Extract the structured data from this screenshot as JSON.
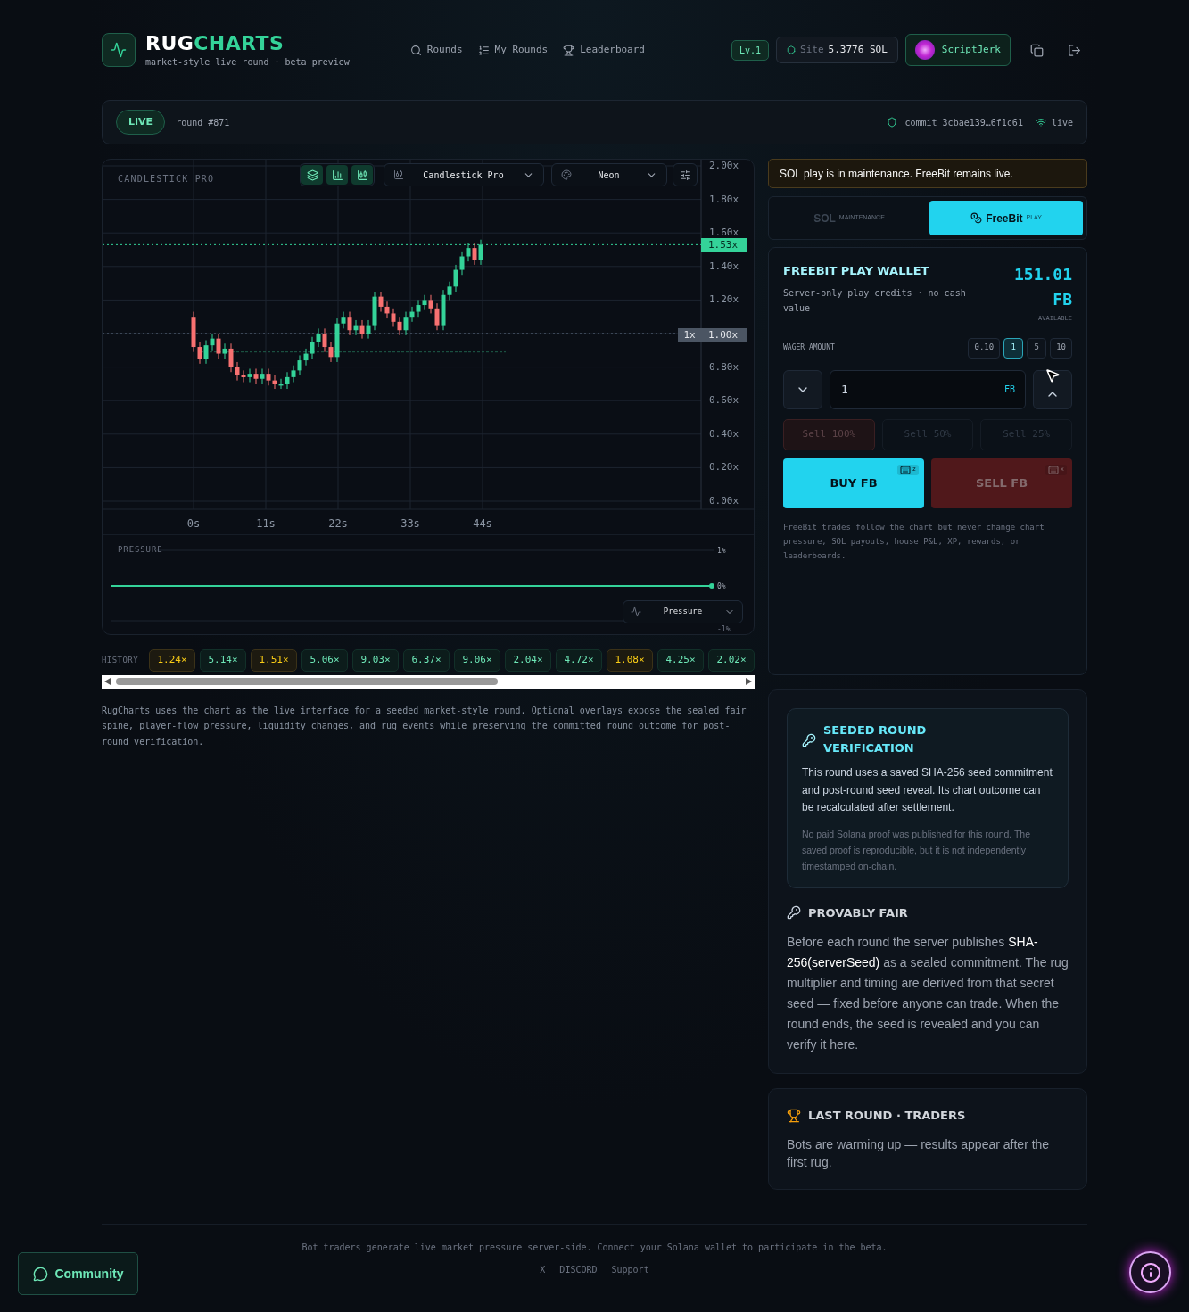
{
  "header": {
    "logo_part_1": "RUG",
    "logo_part_2": "CHARTS",
    "tagline": "market-style live round · beta preview",
    "nav": [
      {
        "label": "Rounds"
      },
      {
        "label": "My Rounds"
      },
      {
        "label": "Leaderboard"
      }
    ],
    "level": "Lv.1",
    "site_label": "Site",
    "site_value": "5.3776 SOL",
    "user": "ScriptJerk"
  },
  "round_bar": {
    "status": "LIVE",
    "round": "round #871",
    "commit": "commit 3cbae139…6f1c61",
    "connection": "live"
  },
  "chart": {
    "title": "CANDLESTICK PRO",
    "style_select": "Candlestick Pro",
    "theme_select": "Neon",
    "y_ticks": [
      "2.00x",
      "1.80x",
      "1.60x",
      "1.40x",
      "1.20x",
      "1.00x",
      "0.80x",
      "0.60x",
      "0.40x",
      "0.20x",
      "0.00x"
    ],
    "x_ticks": [
      "0s",
      "11s",
      "22s",
      "33s",
      "44s"
    ],
    "current_price": "1.53x",
    "baseline_tag": "1x"
  },
  "pressure": {
    "title": "PRESSURE",
    "ticks": [
      "1%",
      "0%",
      "-1%"
    ],
    "select": "Pressure"
  },
  "history": {
    "label": "HISTORY",
    "items": [
      {
        "value": "1.24×",
        "kind": "low"
      },
      {
        "value": "5.14×",
        "kind": "high"
      },
      {
        "value": "1.51×",
        "kind": "low"
      },
      {
        "value": "5.06×",
        "kind": "high"
      },
      {
        "value": "9.03×",
        "kind": "high"
      },
      {
        "value": "6.37×",
        "kind": "high"
      },
      {
        "value": "9.06×",
        "kind": "high"
      },
      {
        "value": "2.04×",
        "kind": "high"
      },
      {
        "value": "4.72×",
        "kind": "high"
      },
      {
        "value": "1.08×",
        "kind": "low"
      },
      {
        "value": "4.25×",
        "kind": "high"
      },
      {
        "value": "2.02×",
        "kind": "high"
      }
    ]
  },
  "description": "RugCharts uses the chart as the live interface for a seeded market-style round. Optional overlays expose the sealed fair spine, player-flow pressure, liquidity changes, and rug events while preserving the committed round outcome for post-round verification.",
  "notice": "SOL play is in maintenance. FreeBit remains live.",
  "mode_tabs": [
    {
      "label": "SOL",
      "badge": "MAINTENANCE",
      "selected": false
    },
    {
      "label": "FreeBit",
      "badge": "PLAY",
      "selected": true
    }
  ],
  "wallet": {
    "title": "FREEBIT PLAY WALLET",
    "subtitle": "Server-only play credits · no cash value",
    "balance": "151.01",
    "unit": "FB",
    "balance_caption": "AVAILABLE",
    "wager_label": "WAGER AMOUNT",
    "presets": [
      {
        "label": "0.10",
        "selected": false
      },
      {
        "label": "1",
        "selected": true
      },
      {
        "label": "5",
        "selected": false
      },
      {
        "label": "10",
        "selected": false
      }
    ],
    "amount": "1",
    "amount_unit": "FB",
    "sell_options": [
      {
        "label": "Sell 100%",
        "kind": "full"
      },
      {
        "label": "Sell 50%",
        "kind": "partial"
      },
      {
        "label": "Sell 25%",
        "kind": "partial"
      }
    ],
    "actions": [
      {
        "label": "BUY FB",
        "kind": "buy",
        "shortcut": "z",
        "disabled": false
      },
      {
        "label": "SELL FB",
        "kind": "sell",
        "shortcut": "x",
        "disabled": true
      }
    ],
    "note": "FreeBit trades follow the chart but never change chart pressure, SOL payouts, house P&L, XP, rewards, or leaderboards."
  },
  "verification": {
    "title": "SEEDED ROUND VERIFICATION",
    "text": "This round uses a saved SHA-256 seed commitment and post-round seed reveal. Its chart outcome can be recalculated after settlement.",
    "note": "No paid Solana proof was published for this round. The saved proof is reproducible, but it is not independently timestamped on-chain."
  },
  "provably_fair": {
    "title": "PROVABLY FAIR",
    "text": "Before each round the server publishes **SHA-256(serverSeed)** as a sealed commitment. The rug multiplier and timing are derived from that secret seed — fixed before anyone can trade. When the round ends, the seed is revealed and you can verify it here."
  },
  "last_round": {
    "title": "LAST ROUND · TRADERS",
    "text": "Bots are warming up — results appear after the first rug."
  },
  "footer": {
    "text": "Bot traders generate live market pressure server-side. Connect your Solana wallet to participate in the beta.",
    "links": [
      "X",
      "DISCORD",
      "Support"
    ]
  },
  "community": "Community"
}
